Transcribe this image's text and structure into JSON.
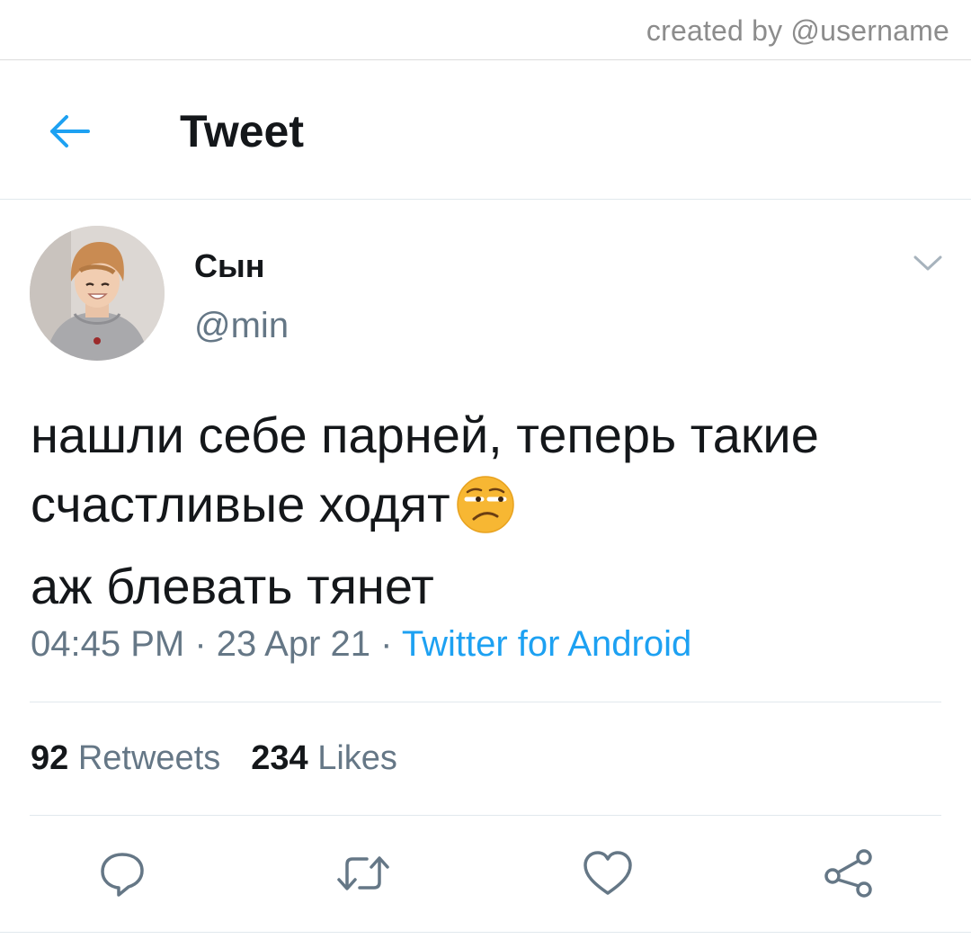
{
  "credit": "created by @username",
  "header": {
    "title": "Tweet"
  },
  "tweet": {
    "author": {
      "display_name": "Сын",
      "handle": "@min"
    },
    "text_lines": [
      "нашли себе парней, теперь такие",
      "счастливые ходят",
      "аж блевать тянет"
    ],
    "emoji": "unamused-face",
    "meta": {
      "time": "04:45 PM",
      "separator": " · ",
      "date": "23 Apr 21",
      "source": "Twitter for Android"
    },
    "stats": {
      "retweets_count": "92",
      "retweets_label": "Retweets",
      "likes_count": "234",
      "likes_label": "Likes"
    }
  },
  "actions": [
    "reply-icon",
    "retweet-icon",
    "heart-icon",
    "share-icon"
  ],
  "colors": {
    "accent": "#1da1f2",
    "text": "#14171a",
    "secondary": "#657786",
    "divider": "#e1e8ed",
    "emoji_face": "#f7b733"
  }
}
